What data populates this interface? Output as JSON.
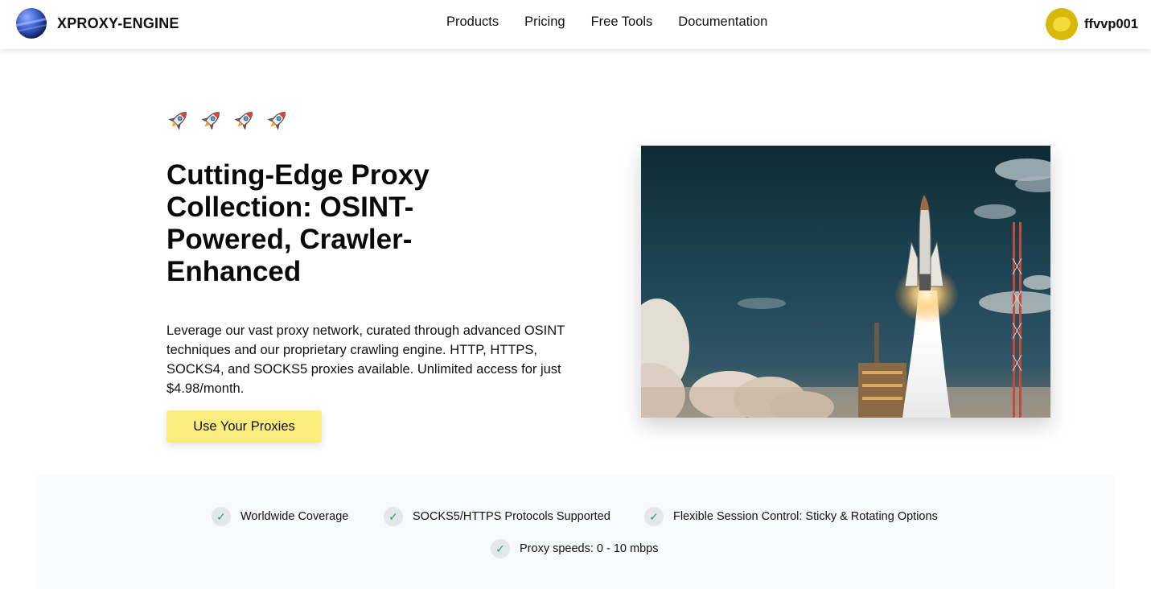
{
  "header": {
    "brand": "XPROXY-ENGINE",
    "nav": [
      "Products",
      "Pricing",
      "Free Tools",
      "Documentation"
    ],
    "username": "ffvvp001"
  },
  "hero": {
    "rocket_icons": [
      "rocket-icon",
      "rocket-icon",
      "rocket-icon",
      "rocket-icon"
    ],
    "title": "Cutting-Edge Proxy Collection: OSINT-Powered, Crawler-Enhanced",
    "description": "Leverage our vast proxy network, curated through advanced OSINT techniques and our proprietary crawling engine. HTTP, HTTPS, SOCKS4, and SOCKS5 proxies available. Unlimited access for just $4.98/month.",
    "cta_label": "Use Your Proxies"
  },
  "features": [
    "Worldwide Coverage",
    "SOCKS5/HTTPS Protocols Supported",
    "Flexible Session Control: Sticky & Rotating Options",
    "Proxy speeds: 0 - 10 mbps"
  ],
  "colors": {
    "accent": "#fbec7e",
    "check": "#1fa463",
    "avatar": "#d8b90a",
    "features_bg": "#f8f9fb"
  }
}
